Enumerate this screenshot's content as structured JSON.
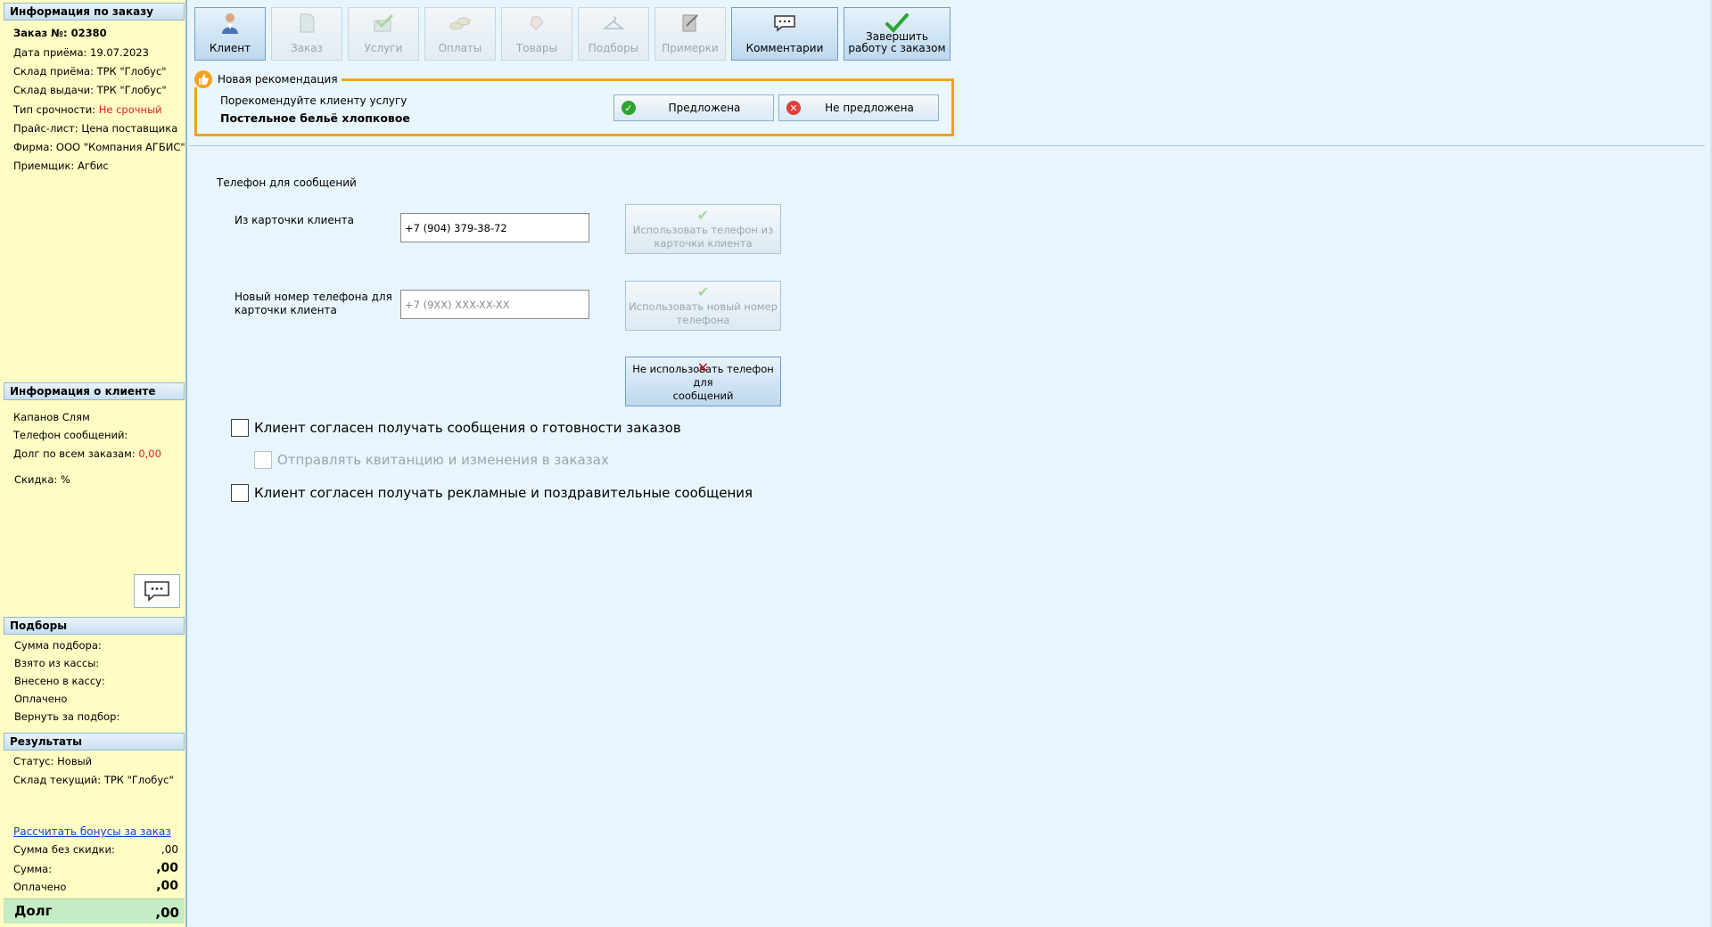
{
  "sidebar": {
    "order_info": {
      "header": "Информация по заказу",
      "order_no": "Заказ №: 02380",
      "date": "Дата приёма: 19.07.2023",
      "warehouse_in": "Склад приёма: ТРК \"Глобус\"",
      "warehouse_out": "Склад выдачи: ТРК \"Глобус\"",
      "urgency_label": "Тип срочности: ",
      "urgency_value": "Не срочный",
      "price_list": "Прайс-лист: Цена поставщика",
      "firm": "Фирма: ООО \"Компания АГБИС\"",
      "receiver": "Приемщик: Агбис"
    },
    "client_info": {
      "header": "Информация о клиенте",
      "name": "Капанов Слям",
      "phone": "Телефон сообщений:",
      "debt_label": "Долг по всем заказам: ",
      "debt_value": "0,00",
      "discount": "Скидка: %"
    },
    "selections": {
      "header": "Подборы",
      "sum": "Сумма подбора:",
      "taken": "Взято из кассы:",
      "deposited": "Внесено в кассу:",
      "paid": "Оплачено",
      "return": "Вернуть за подбор:"
    },
    "results": {
      "header": "Результаты",
      "status": "Статус: Новый",
      "current_wh": "Склад текущий: ТРК \"Глобус\"",
      "bonus_link": "Рассчитать бонусы за заказ",
      "sum_no_discount_label": "Сумма без скидки:",
      "sum_no_discount_value": ",00",
      "sum_label": "Сумма:",
      "sum_value": ",00",
      "paid_label": "Оплачено",
      "paid_value": ",00",
      "debt_label": "Долг",
      "debt_value": ",00"
    }
  },
  "toolbar": {
    "client": "Клиент",
    "order": "Заказ",
    "services": "Услуги",
    "payments": "Оплаты",
    "goods": "Товары",
    "selections": "Подборы",
    "fittings": "Примерки",
    "comments": "Комментарии",
    "finish_line1": "Завершить",
    "finish_line2": "работу с заказом"
  },
  "recommendation": {
    "title": "Новая рекомендация",
    "prompt": "Порекомендуйте клиенту услугу",
    "service": "Постельное бельё хлопковое",
    "offered": "Предложена",
    "not_offered": "Не предложена"
  },
  "phone": {
    "section_title": "Телефон для сообщений",
    "from_card_label": "Из карточки клиента",
    "from_card_value": "+7 (904) 379-38-72",
    "new_label_line1": "Новый номер телефона для",
    "new_label_line2": "карточки клиента",
    "new_placeholder": "+7 (9XX) XXX-XX-XX",
    "use_card_line1": "Использовать телефон из",
    "use_card_line2": "карточки клиента",
    "use_new_line1": "Использовать новый номер",
    "use_new_line2": "телефона",
    "dont_use_line1": "Не использовать телефон для",
    "dont_use_line2": "сообщений"
  },
  "checkboxes": {
    "ready": "Клиент согласен получать сообщения о готовности заказов",
    "receipt": "Отправлять квитанцию и изменения в заказах",
    "ads": "Клиент согласен получать рекламные и поздравительные сообщения"
  },
  "colors": {
    "accent_orange": "#f3a21e",
    "sidebar_bg": "#fffdc4",
    "content_bg": "#e8f5fc",
    "debt_green": "#c5ecc4",
    "red": "#e02020"
  }
}
